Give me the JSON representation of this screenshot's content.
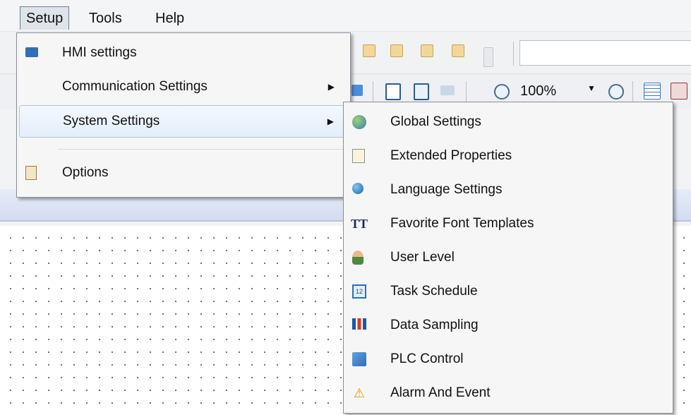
{
  "menubar": {
    "items": [
      "Setup",
      "Tools",
      "Help"
    ]
  },
  "toolbar": {
    "zoom": "100%"
  },
  "setup_menu": {
    "items": [
      {
        "label": "HMI settings",
        "icon": "monitor-gear-icon"
      },
      {
        "label": "Communication Settings",
        "submenu": true
      },
      {
        "label": "System Settings",
        "submenu": true,
        "highlighted": true
      },
      {
        "label": "Options",
        "icon": "clipboard-checklist-icon"
      }
    ]
  },
  "system_settings_menu": {
    "items": [
      {
        "label": "Global Settings",
        "icon": "globe-gear-icon"
      },
      {
        "label": "Extended Properties",
        "icon": "properties-gear-icon"
      },
      {
        "label": "Language Settings",
        "icon": "globe-stand-icon"
      },
      {
        "label": "Favorite Font Templates",
        "icon": "font-tt-icon",
        "icon_text": "TT"
      },
      {
        "label": "User Level",
        "icon": "user-lock-icon"
      },
      {
        "label": "Task Schedule",
        "icon": "calendar-icon",
        "icon_text": "12"
      },
      {
        "label": "Data Sampling",
        "icon": "bar-chart-icon"
      },
      {
        "label": "PLC Control",
        "icon": "plc-gear-icon"
      },
      {
        "label": "Alarm And Event",
        "icon": "alarm-warning-icon"
      }
    ]
  }
}
